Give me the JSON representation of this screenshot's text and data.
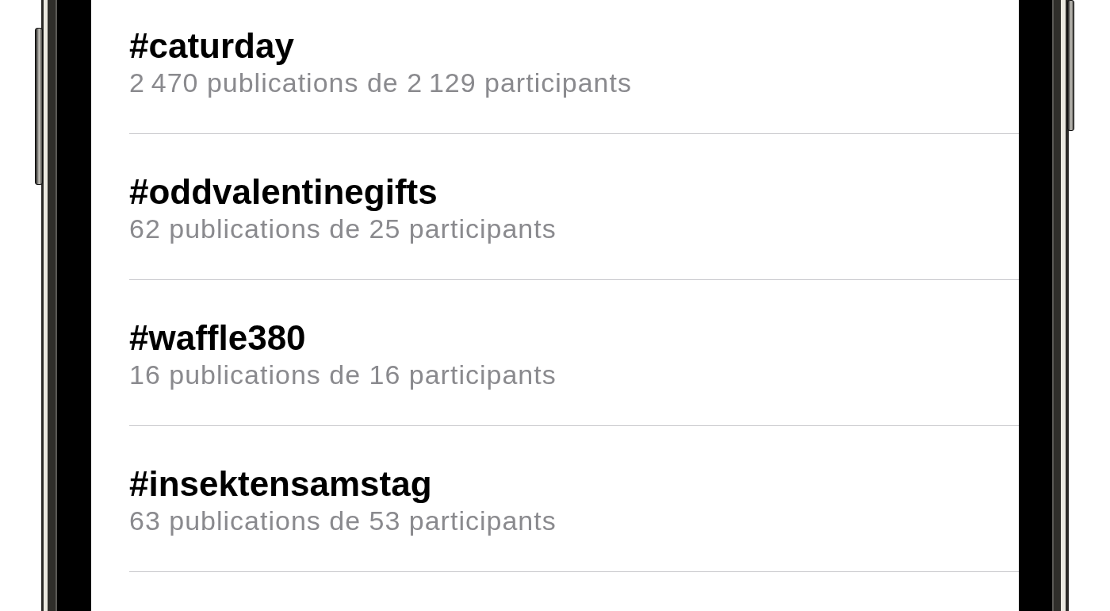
{
  "hashtags": [
    {
      "tag": "#caturday",
      "stats": "2 470 publications de 2 129 participants"
    },
    {
      "tag": "#oddvalentinegifts",
      "stats": "62 publications de 25 participants"
    },
    {
      "tag": "#waffle380",
      "stats": "16 publications de 16 participants"
    },
    {
      "tag": "#insektensamstag",
      "stats": "63 publications de 53 participants"
    }
  ]
}
